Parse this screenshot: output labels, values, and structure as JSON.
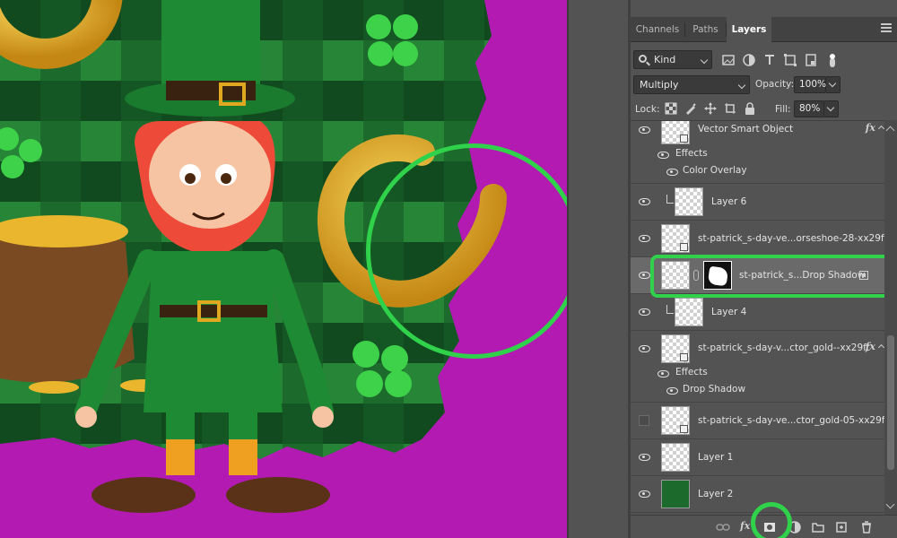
{
  "panel": {
    "tabs": [
      {
        "label": "Channels",
        "active": false
      },
      {
        "label": "Paths",
        "active": false
      },
      {
        "label": "Layers",
        "active": true
      }
    ],
    "kind_filter": "Kind",
    "blend_mode": "Multiply",
    "opacity_label": "Opacity:",
    "opacity_value": "100%",
    "lock_label": "Lock:",
    "fill_label": "Fill:",
    "fill_value": "80%"
  },
  "layers": [
    {
      "name": "Vector Smart Object",
      "visible": true,
      "fx": true,
      "effects_label": "Effects",
      "effects": [
        "Color Overlay"
      ]
    },
    {
      "name": "Layer 6",
      "visible": true,
      "clipped": true
    },
    {
      "name": "st-patrick_s-day-ve...orseshoe-28-xx29ft...",
      "visible": true
    },
    {
      "name": "st-patrick_s...Drop Shadow",
      "visible": true,
      "mask": true,
      "selected": true
    },
    {
      "name": "Layer 4",
      "visible": true,
      "clipped": true
    },
    {
      "name": "st-patrick_s-day-v...ctor_gold--xx29ft",
      "visible": true,
      "fx": true,
      "effects_label": "Effects",
      "effects": [
        "Drop Shadow"
      ]
    },
    {
      "name": "st-patrick_s-day-ve...ctor_gold-05-xx29ft",
      "visible": false
    },
    {
      "name": "Layer 1",
      "visible": true
    },
    {
      "name": "Layer 2",
      "visible": true
    }
  ],
  "colors": {
    "canvas_bg": "#b21ab2",
    "plaid_dark": "#0f4a1e",
    "plaid_light": "#2f9a3f",
    "highlight": "#2fd24a",
    "gold": "#e0a821"
  },
  "icons": {
    "fx": "fx",
    "bottom": [
      "link-icon",
      "fx-icon",
      "mask-icon",
      "adjustment-icon",
      "folder-icon",
      "new-layer-icon",
      "trash-icon"
    ]
  }
}
